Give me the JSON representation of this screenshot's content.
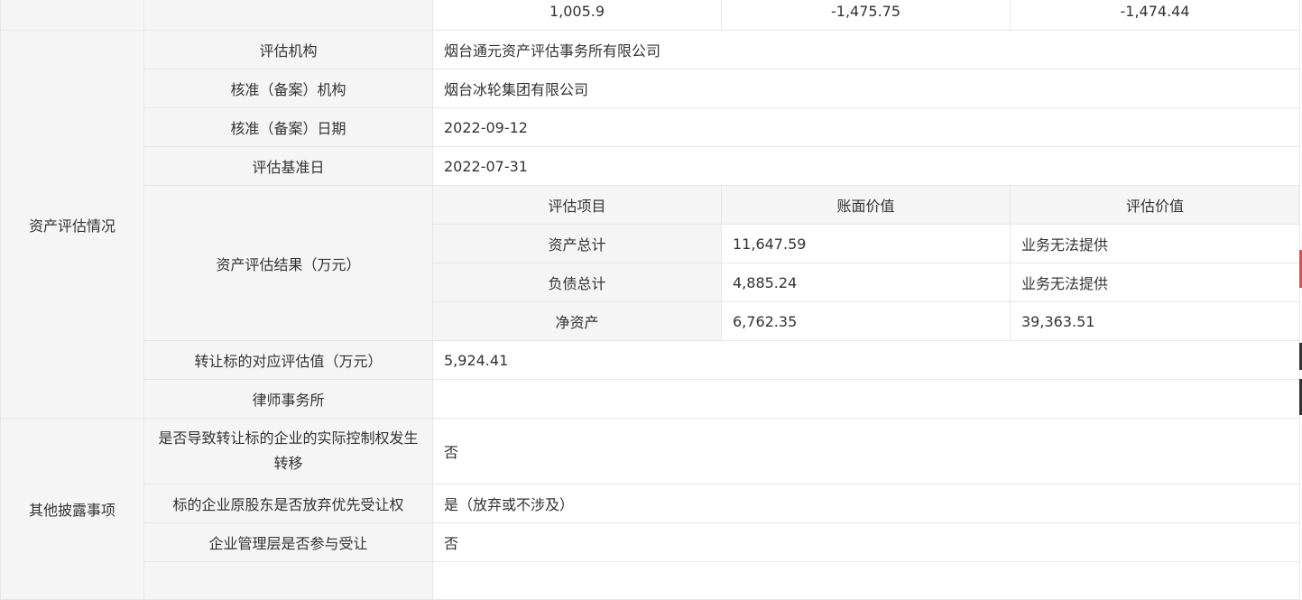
{
  "top_row": {
    "value_1": "1,005.9",
    "value_2": "-1,475.75",
    "value_3": "-1,474.44"
  },
  "asset_eval": {
    "section_title": "资产评估情况",
    "rows": [
      {
        "label": "评估机构",
        "value": "烟台通元资产评估事务所有限公司"
      },
      {
        "label": "核准（备案）机构",
        "value": "烟台冰轮集团有限公司"
      },
      {
        "label": "核准（备案）日期",
        "value": "2022-09-12"
      },
      {
        "label": "评估基准日",
        "value": "2022-07-31"
      }
    ],
    "result": {
      "label": "资产评估结果（万元）",
      "headers": [
        "评估项目",
        "账面价值",
        "评估价值"
      ],
      "rows": [
        {
          "item": "资产总计",
          "book": "11,647.59",
          "eval": "业务无法提供"
        },
        {
          "item": "负债总计",
          "book": "4,885.24",
          "eval": "业务无法提供"
        },
        {
          "item": "净资产",
          "book": "6,762.35",
          "eval": "39,363.51"
        }
      ]
    },
    "transfer_value": {
      "label": "转让标的对应评估值（万元）",
      "value": "5,924.41"
    },
    "law_firm": {
      "label": "律师事务所",
      "value": ""
    }
  },
  "other": {
    "section_title": "其他披露事项",
    "rows": [
      {
        "label": "是否导致转让标的企业的实际控制权发生转移",
        "value": "否"
      },
      {
        "label": "标的企业原股东是否放弃优先受让权",
        "value": "是（放弃或不涉及）"
      },
      {
        "label": "企业管理层是否参与受让",
        "value": "否"
      }
    ]
  }
}
